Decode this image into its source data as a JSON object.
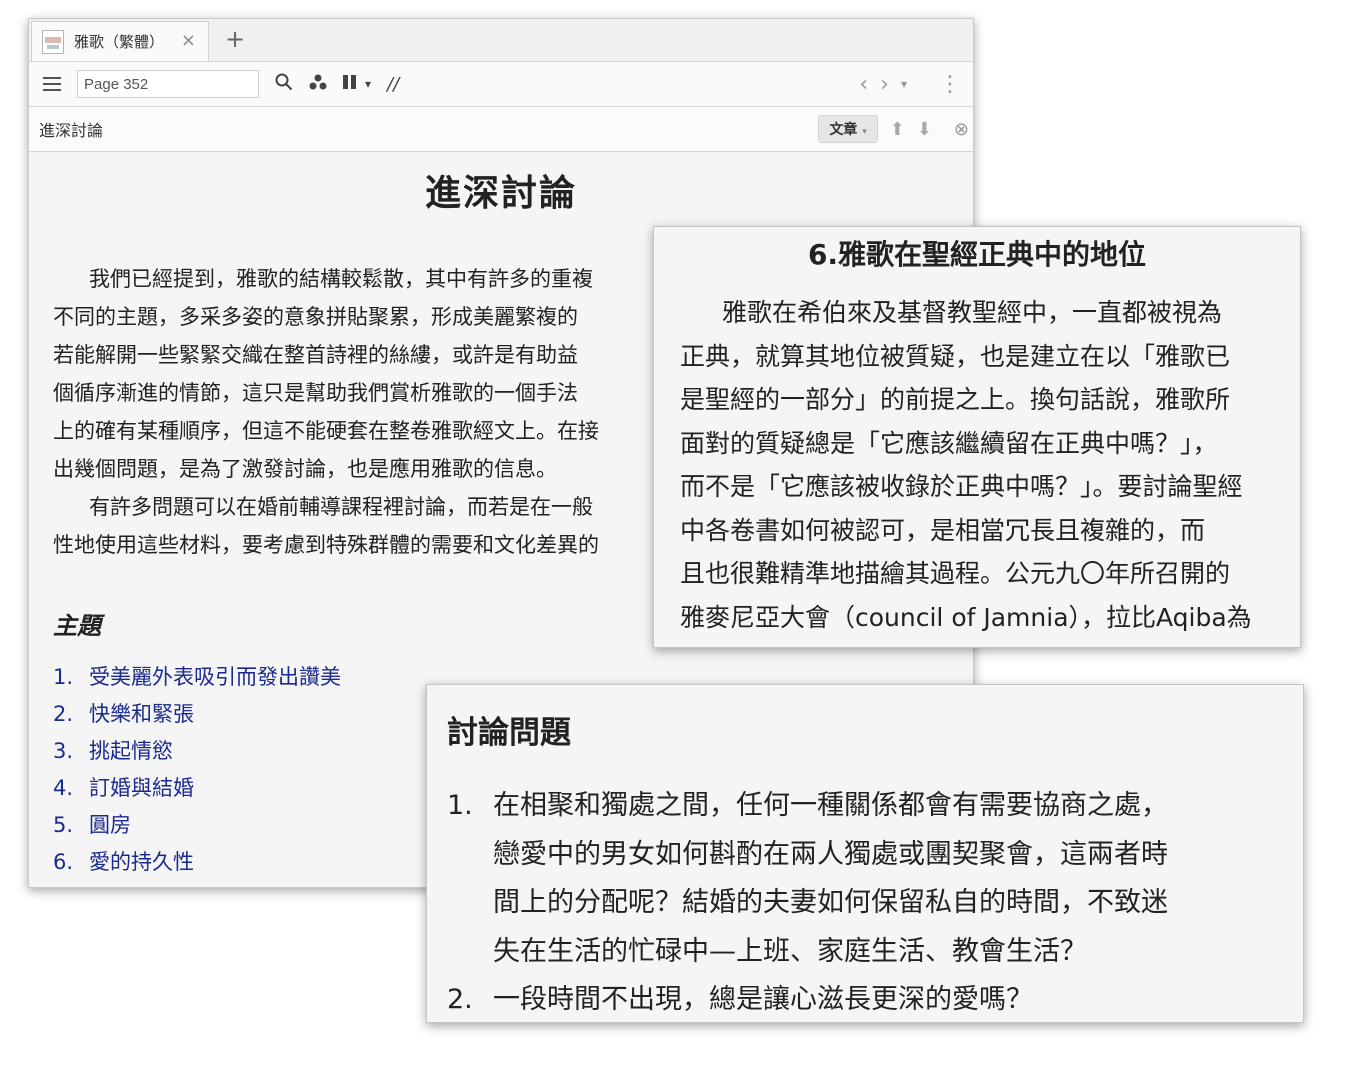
{
  "tab": {
    "title": "雅歌（繁體）",
    "close": "×",
    "new": "+"
  },
  "toolbar": {
    "page": "Page 352",
    "search_icon": "🔍",
    "share_icon": "⁂",
    "pause_icon": "❚❚",
    "dropdown": "▾",
    "parallel": "//",
    "back": "‹",
    "forward": "›",
    "history_dropdown": "▾",
    "more": "⋮"
  },
  "searchbar": {
    "query": "進深討論",
    "mode": "文章",
    "mode_arrow": "▾",
    "up": "⬆",
    "down": "⬇",
    "clear": "⊗"
  },
  "document": {
    "title": "進深討論",
    "paragraph1_lines": [
      "我們已經提到，雅歌的結構較鬆散，其中有許多的重複",
      "不同的主題，多采多姿的意象拼貼聚累，形成美麗繁複的",
      "若能解開一些緊緊交織在整首詩裡的絲縷，或許是有助益",
      "個循序漸進的情節，這只是幫助我們賞析雅歌的一個手法",
      "上的確有某種順序，但這不能硬套在整卷雅歌經文上。在接",
      "出幾個問題，是為了激發討論，也是應用雅歌的信息。"
    ],
    "paragraph2_lines": [
      "有許多問題可以在婚前輔導課程裡討論，而若是在一般",
      "性地使用這些材料，要考慮到特殊群體的需要和文化差異的"
    ],
    "section_heading": "主題",
    "topics": [
      {
        "num": "1.",
        "label": "受美麗外表吸引而發出讚美"
      },
      {
        "num": "2.",
        "label": "快樂和緊張"
      },
      {
        "num": "3.",
        "label": "挑起情慾"
      },
      {
        "num": "4.",
        "label": "訂婚與結婚"
      },
      {
        "num": "5.",
        "label": "圓房"
      },
      {
        "num": "6.",
        "label": "愛的持久性"
      }
    ]
  },
  "popup_canon": {
    "heading": "6.雅歌在聖經正典中的地位",
    "lines": [
      "雅歌在希伯來及基督教聖經中，一直都被視為",
      "正典，就算其地位被質疑，也是建立在以「雅歌已",
      "是聖經的一部分」的前提之上。換句話說，雅歌所",
      "面對的質疑總是「它應該繼續留在正典中嗎？」，",
      "而不是「它應該被收錄於正典中嗎？」。要討論聖經",
      "中各卷書如何被認可，是相當冗長且複雜的，而",
      "且也很難精準地描繪其過程。公元九〇年所召開的",
      "雅麥尼亞大會（council of Jamnia），拉比Aqiba為"
    ]
  },
  "popup_questions": {
    "heading": "討論問題",
    "questions": [
      {
        "num": "1.",
        "lines": [
          "在相聚和獨處之間，任何一種關係都會有需要協商之處，",
          "戀愛中的男女如何斟酌在兩人獨處或團契聚會，這兩者時",
          "間上的分配呢？結婚的夫妻如何保留私自的時間，不致迷",
          "失在生活的忙碌中—上班、家庭生活、教會生活？"
        ]
      },
      {
        "num": "2.",
        "lines": [
          "一段時間不出現，總是讓心滋長更深的愛嗎？"
        ]
      }
    ]
  }
}
